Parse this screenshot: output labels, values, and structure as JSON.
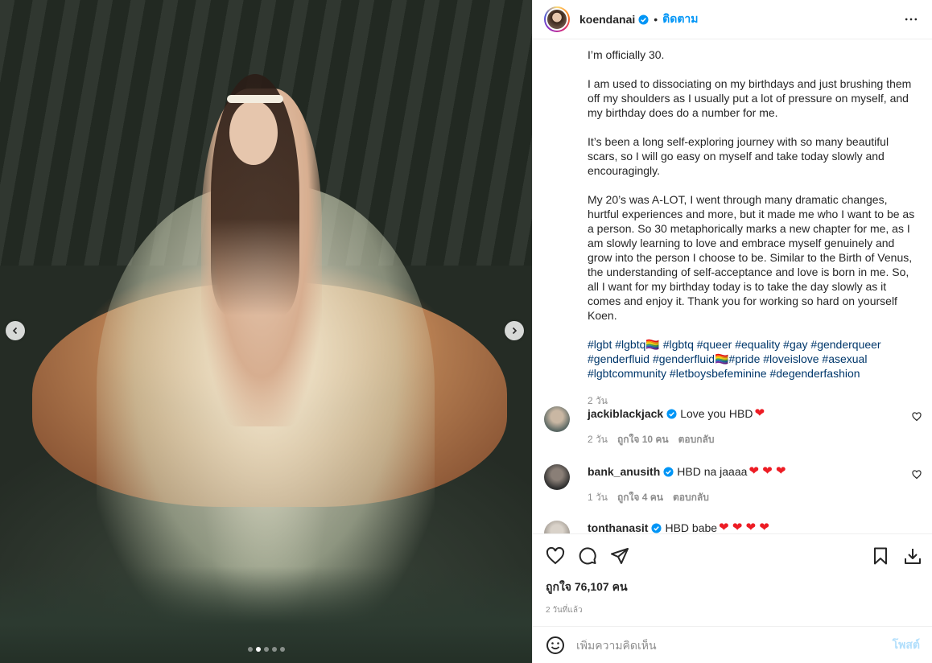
{
  "post": {
    "username": "koendanai",
    "separator": "•",
    "follow_label": "ติดตาม",
    "caption_paragraphs": [
      "I’m officially 30.",
      "I am used to dissociating on my birthdays and just brushing them off my shoulders as I usually put a lot of pressure on myself, and my birthday does do a number for me.",
      "It’s been a long self-exploring journey with so many beautiful scars, so I will go easy on myself and take today slowly and encouragingly.",
      "My 20’s was A-LOT, I went through many dramatic changes, hurtful experiences and more, but it made me who I want to be as a person. So 30 metaphorically marks a new chapter for me, as I am slowly learning to love and embrace myself genuinely and grow into the person I choose to be. Similar to the Birth of Venus, the understanding of self-acceptance and love is born in me. So, all I want for my birthday today is to take the day slowly as it comes and enjoy it. Thank you for working so hard on yourself Koen."
    ],
    "hashtags": "#lgbt #lgbtq🏳️‍🌈 #lgbtq #queer #equality #gay #genderqueer #genderfluid #genderfluid🏳️‍🌈#pride #loveislove #asexual #lgbtcommunity #letboysbefeminine #degenderfashion",
    "caption_time": "2 วัน",
    "likes_label": "ถูกใจ 76,107 คน",
    "posted_ago": "2 วันที่แล้ว"
  },
  "comments": [
    {
      "user": "jackiblackjack",
      "text": "Love you HBD",
      "hearts": "❤",
      "age": "2 วัน",
      "likes": "ถูกใจ 10 คน",
      "reply": "ตอบกลับ",
      "avatar_color": "#7d8a86"
    },
    {
      "user": "bank_anusith",
      "text": "HBD na jaaaa",
      "hearts": "❤ ❤ ❤",
      "age": "1 วัน",
      "likes": "ถูกใจ 4 คน",
      "reply": "ตอบกลับ",
      "avatar_color": "#3a3a3a"
    },
    {
      "user": "tonthanasit",
      "text": "HBD babe",
      "hearts": "❤ ❤ ❤ ❤",
      "age": "",
      "likes": "",
      "reply": "",
      "avatar_color": "#b9b3ab"
    }
  ],
  "composer": {
    "placeholder": "เพิ่มความคิดเห็น",
    "post_label": "โพสต์"
  },
  "carousel": {
    "count": 5,
    "active": 1
  },
  "colors": {
    "accent": "#0095f6",
    "link": "#00376b",
    "muted": "#8e8e8e",
    "heart": "#ed1c24"
  },
  "icons": [
    "verified-badge-icon",
    "more-options-icon",
    "like-icon",
    "comment-icon",
    "share-icon",
    "save-icon",
    "download-icon",
    "emoji-icon",
    "chevron-left-icon",
    "chevron-right-icon"
  ]
}
